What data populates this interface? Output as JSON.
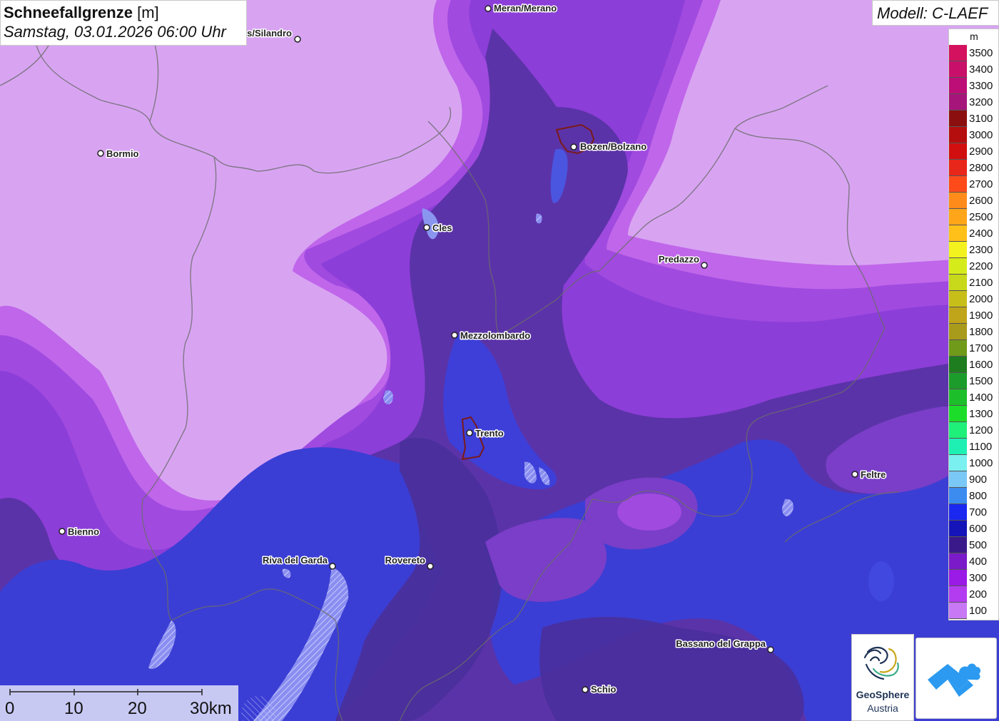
{
  "title": {
    "parameter": "Schneefallgrenze",
    "unit": "[m]",
    "datetime": "Samstag, 03.01.2026 06:00 Uhr"
  },
  "model": {
    "label": "Modell: C-LAEF"
  },
  "legend": {
    "unit": "m",
    "entries": [
      {
        "label": "3500",
        "color": "#d4115f"
      },
      {
        "label": "3400",
        "color": "#c8106a"
      },
      {
        "label": "3300",
        "color": "#bd0e77"
      },
      {
        "label": "3200",
        "color": "#a6157a"
      },
      {
        "label": "3100",
        "color": "#8c0f0f"
      },
      {
        "label": "3000",
        "color": "#b50e0e"
      },
      {
        "label": "2900",
        "color": "#d10f0f"
      },
      {
        "label": "2800",
        "color": "#e8261a"
      },
      {
        "label": "2700",
        "color": "#ff4a1a"
      },
      {
        "label": "2600",
        "color": "#ff8c1a"
      },
      {
        "label": "2500",
        "color": "#ffa51a"
      },
      {
        "label": "2400",
        "color": "#ffc01a"
      },
      {
        "label": "2300",
        "color": "#f4f21e"
      },
      {
        "label": "2200",
        "color": "#d6ec1a"
      },
      {
        "label": "2100",
        "color": "#c8d81a"
      },
      {
        "label": "2000",
        "color": "#c8be1a"
      },
      {
        "label": "1900",
        "color": "#c0a41a"
      },
      {
        "label": "1800",
        "color": "#a89a1a"
      },
      {
        "label": "1700",
        "color": "#6f9a1a"
      },
      {
        "label": "1600",
        "color": "#1e7d1e"
      },
      {
        "label": "1500",
        "color": "#1c9c2a"
      },
      {
        "label": "1400",
        "color": "#1cbe2a"
      },
      {
        "label": "1300",
        "color": "#1cde2a"
      },
      {
        "label": "1200",
        "color": "#1ef07a"
      },
      {
        "label": "1100",
        "color": "#1ef0b4"
      },
      {
        "label": "1000",
        "color": "#7af0f0"
      },
      {
        "label": "900",
        "color": "#7ac8f5"
      },
      {
        "label": "800",
        "color": "#3c8cf0"
      },
      {
        "label": "700",
        "color": "#1a28f0"
      },
      {
        "label": "600",
        "color": "#1414b8"
      },
      {
        "label": "500",
        "color": "#3a1a8a"
      },
      {
        "label": "400",
        "color": "#7a1ac8"
      },
      {
        "label": "300",
        "color": "#9a1ae6"
      },
      {
        "label": "200",
        "color": "#b43cf0"
      },
      {
        "label": "100",
        "color": "#c878f5"
      }
    ]
  },
  "cities": [
    {
      "name": "Meran/Merano"
    },
    {
      "name": "s/Silandro"
    },
    {
      "name": "Bormio"
    },
    {
      "name": "Bozen/Bolzano"
    },
    {
      "name": "Cles"
    },
    {
      "name": "Predazzo"
    },
    {
      "name": "Mezzolombardo"
    },
    {
      "name": "Trento"
    },
    {
      "name": "Feltre"
    },
    {
      "name": "Bienno"
    },
    {
      "name": "Riva del Garda"
    },
    {
      "name": "Rovereto"
    },
    {
      "name": "Bassano del Grappa"
    },
    {
      "name": "Schio"
    }
  ],
  "scale_bar": {
    "labels": [
      "0",
      "10",
      "20",
      "30km"
    ]
  },
  "logos": {
    "geosphere_line1": "GeoSphere",
    "geosphere_line2": "Austria"
  }
}
